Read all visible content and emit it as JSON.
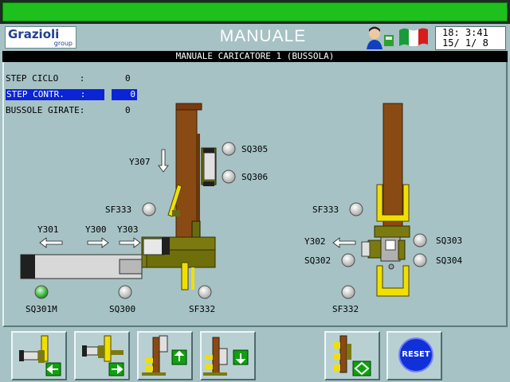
{
  "header": {
    "logo_brand": "Grazioli",
    "logo_sub": "group",
    "title": "MANUALE",
    "clock_line1": "18: 3:41",
    "clock_line2": "15/ 1/ 8"
  },
  "subtitle": "MANUALE CARICATORE 1 (BUSSOLA)",
  "status": [
    {
      "label": "STEP CICLO    :",
      "value": "0"
    },
    {
      "label": "STEP CONTR.   :",
      "value": "0"
    },
    {
      "label": "BUSSOLE GIRATE:",
      "value": "0"
    }
  ],
  "left_station": {
    "labels": {
      "sq305": "SQ305",
      "sq306": "SQ306",
      "y307": "Y307",
      "sf333": "SF333",
      "y301": "Y301",
      "y300": "Y300",
      "y303": "Y303",
      "sq301m": "SQ301M",
      "sq300": "SQ300",
      "sf332": "SF332"
    }
  },
  "right_station": {
    "labels": {
      "sf333": "SF333",
      "y302": "Y302",
      "sq303": "SQ303",
      "sq302": "SQ302",
      "sq304": "SQ304",
      "sf332": "SF332"
    }
  },
  "lamps": {
    "sq301m_active": true
  },
  "toolbar": {
    "reset_label": "RESET"
  },
  "colors": {
    "background": "#a6c2c4",
    "status_bar": "#1ec01e",
    "selection": "#0a24d6",
    "lamp_on": "#22c022",
    "lamp_off": "#e6e6e6",
    "frame_brown": "#8a4a14",
    "olive": "#7a7a10",
    "yellow": "#f0e000",
    "reset": "#1030d8"
  },
  "icons": [
    "user-icon",
    "italy-flag-icon",
    "arrow-left-icon",
    "arrow-right-icon",
    "arrow-up-icon",
    "arrow-down-icon",
    "diamond-icon"
  ]
}
